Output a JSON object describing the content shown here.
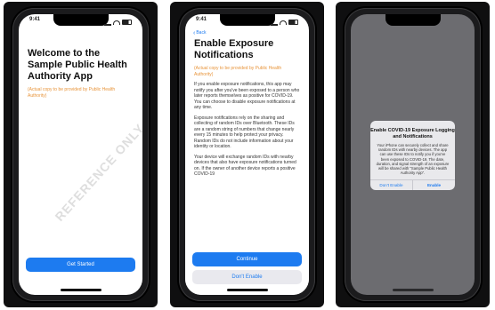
{
  "status_bar": {
    "time": "9:41"
  },
  "screen1": {
    "title": "Welcome to the Sample Public Health Authority App",
    "note": "(Actual copy to be provided by Public Health Authority)",
    "watermark": "REFERENCE ONLY",
    "get_started_label": "Get Started"
  },
  "screen2": {
    "back_label": "Back",
    "title": "Enable Exposure Notifications",
    "note": "(Actual copy to be provided by Public Health Authority)",
    "paragraphs": [
      "If you enable exposure notifications, this app may notify you after you've been exposed to a person who later reports themselves as positive for COVID-19. You can choose to disable exposure notifications at any time.",
      "Exposure notifications rely on the sharing and collecting of random IDs over Bluetooth. These IDs are a random string of numbers that change nearly every 15 minutes to help protect your privacy. Random IDs do not include information about your identity or location.",
      "Your device will exchange random IDs with nearby devices that also have exposure notifications turned on. If the owner of another device reports a positive COVID-19"
    ],
    "continue_label": "Continue",
    "dont_enable_label": "Don't Enable"
  },
  "screen3": {
    "dialog_title": "Enable COVID-19 Exposure Logging and Notifications",
    "dialog_message": "Your iPhone can securely collect and share random IDs with nearby devices. The app can use these IDs to notify you if you've been exposed to COVID-19. The date, duration, and signal strength of an exposure will be shared with \"Sample Public Health Authority App\".",
    "dont_enable_label": "Don't Enable",
    "enable_label": "Enable"
  },
  "colors": {
    "accent": "#1d7bf0",
    "note": "#e8943a",
    "background": "#0f0f10"
  }
}
